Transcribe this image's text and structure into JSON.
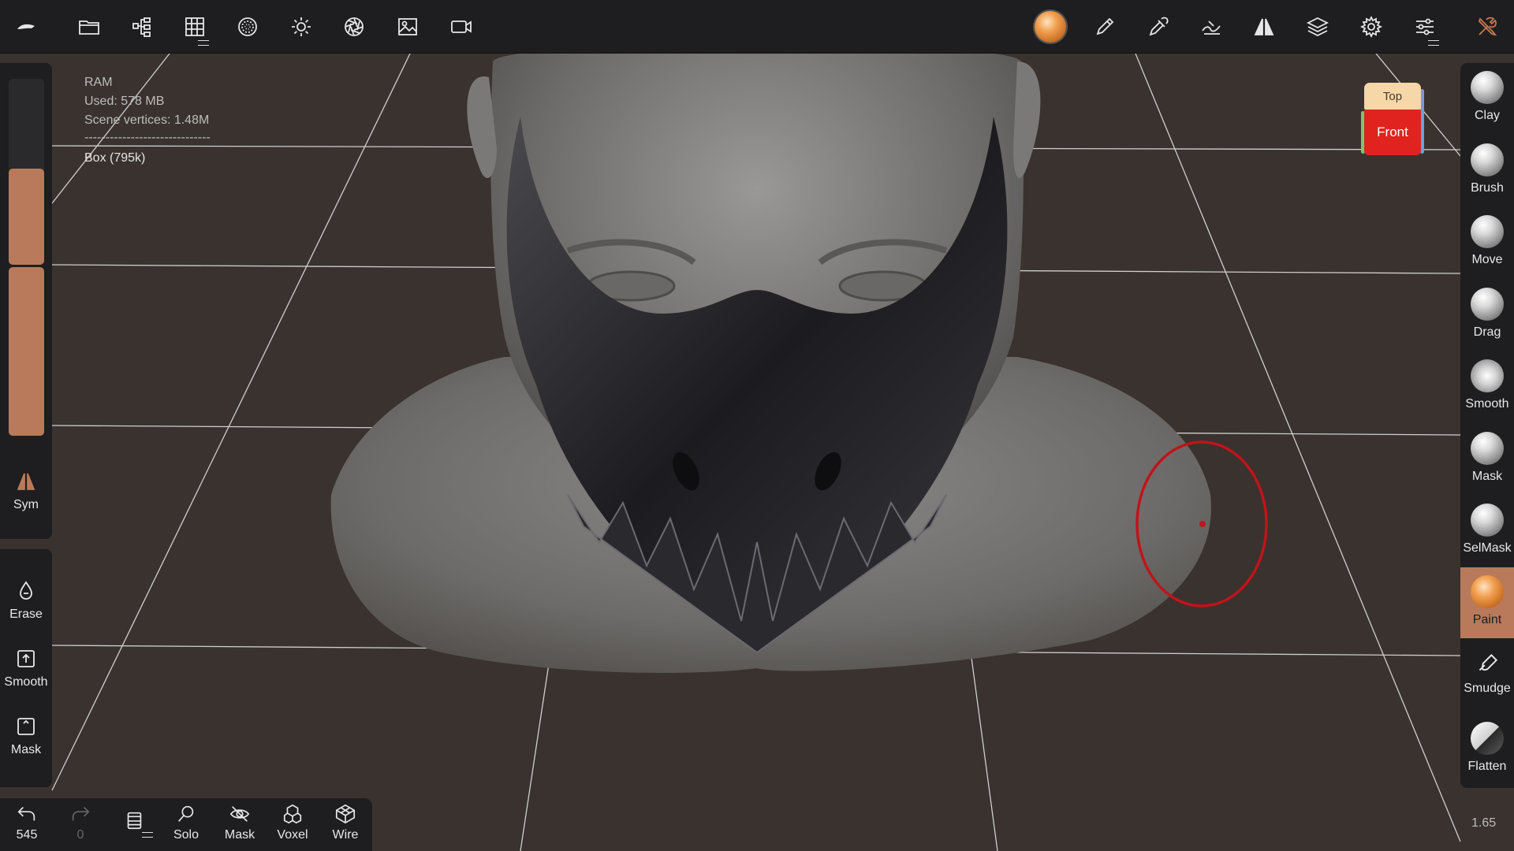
{
  "toolbar": {
    "icons": [
      "app-logo-icon",
      "folder-icon",
      "scene-tree-icon",
      "grid-icon",
      "topology-icon",
      "light-icon",
      "aperture-icon",
      "image-icon",
      "camera-icon"
    ],
    "right_icons": [
      "material-sphere-icon",
      "pen-icon",
      "eyedropper-icon",
      "stroke-icon",
      "symmetry-icon",
      "layers-icon",
      "settings-icon",
      "sliders-icon",
      "tools-icon"
    ]
  },
  "info": {
    "ram_label": "RAM",
    "used": "Used: 578 MB",
    "vertices": "Scene vertices: 1.48M",
    "separator": "------------------------------",
    "object": "Box (795k)"
  },
  "nav_cube": {
    "top": "Top",
    "front": "Front"
  },
  "left_panel": {
    "sym_label": "Sym",
    "slider_radius_level": 1.0,
    "slider_intensity_level": 1.0,
    "tools": [
      {
        "label": "Erase"
      },
      {
        "label": "Smooth"
      },
      {
        "label": "Mask"
      }
    ]
  },
  "bottom_bar": {
    "undo_count": "545",
    "redo_count": "0",
    "items": [
      {
        "label": "Solo"
      },
      {
        "label": "Mask"
      },
      {
        "label": "Voxel"
      },
      {
        "label": "Wire"
      }
    ]
  },
  "right_tools": [
    {
      "label": "Clay",
      "active": false
    },
    {
      "label": "Brush",
      "active": false
    },
    {
      "label": "Move",
      "active": false
    },
    {
      "label": "Drag",
      "active": false
    },
    {
      "label": "Smooth",
      "active": false
    },
    {
      "label": "Mask",
      "active": false
    },
    {
      "label": "SelMask",
      "active": false
    },
    {
      "label": "Paint",
      "active": true
    },
    {
      "label": "Smudge",
      "active": false
    },
    {
      "label": "Flatten",
      "active": false
    }
  ],
  "zoom": "1.65",
  "colors": {
    "accent": "#b87a5a",
    "panel": "#1e1e20",
    "background": "#3a322e",
    "cursor": "#c0141a"
  }
}
